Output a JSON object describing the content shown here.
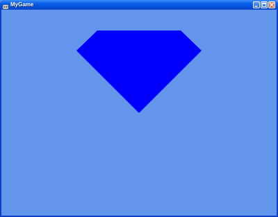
{
  "window": {
    "title": "MyGame",
    "icon": "app-icon",
    "controls": {
      "minimize_icon": "minimize-icon",
      "maximize_icon": "maximize-icon",
      "close_icon": "close-icon"
    }
  },
  "scene": {
    "background_color": "#6495ED",
    "shape": {
      "type": "diamond-gem",
      "fill_color": "#0000FF"
    }
  }
}
